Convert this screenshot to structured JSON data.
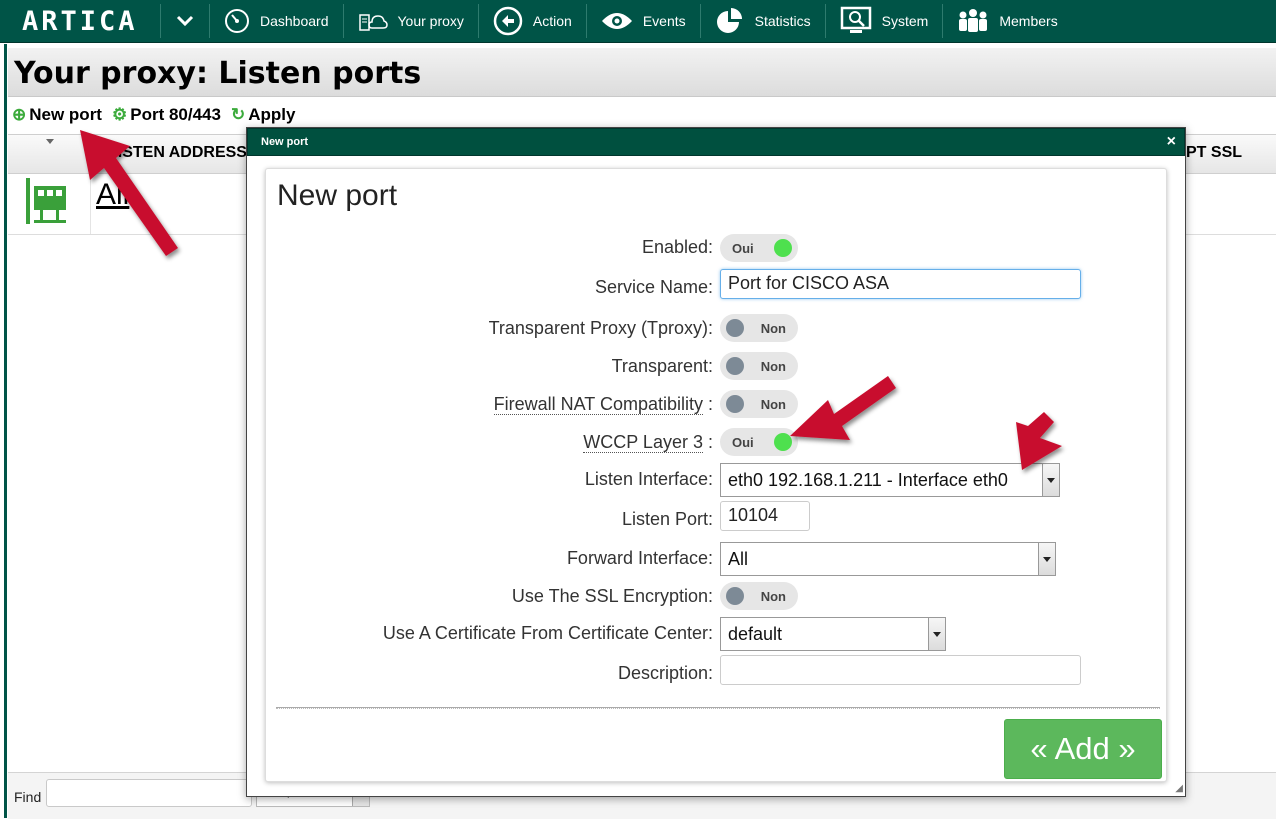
{
  "nav": {
    "logo": "ARTICA",
    "items": [
      {
        "label": "Dashboard",
        "icon": "dashboard-icon"
      },
      {
        "label": "Your proxy",
        "icon": "proxy-icon"
      },
      {
        "label": "Action",
        "icon": "action-icon"
      },
      {
        "label": "Events",
        "icon": "eye-icon"
      },
      {
        "label": "Statistics",
        "icon": "pie-chart-icon"
      },
      {
        "label": "System",
        "icon": "system-icon"
      },
      {
        "label": "Members",
        "icon": "members-icon"
      }
    ]
  },
  "page": {
    "title": "Your proxy: Listen ports",
    "toolbar": {
      "new_port": "New port",
      "port_80_443": "Port 80/443",
      "apply": "Apply"
    },
    "grid": {
      "columns": [
        "LISTEN ADDRESS",
        "PT SSL"
      ],
      "rows": [
        {
          "address": "All"
        }
      ]
    },
    "footer": {
      "find_label": "Find",
      "find_value": "",
      "search_field": "listen port"
    }
  },
  "modal": {
    "title": "New port",
    "close": "×",
    "panel_title": "New port",
    "fields": {
      "enabled": {
        "label": "Enabled:",
        "state": "Oui"
      },
      "service_name": {
        "label": "Service Name:",
        "value": "Port for CISCO ASA"
      },
      "tproxy": {
        "label": "Transparent Proxy (Tproxy):",
        "state": "Non"
      },
      "transparent": {
        "label": "Transparent:",
        "state": "Non"
      },
      "firewall_nat": {
        "label": "Firewall NAT Compatibility",
        "state": "Non"
      },
      "wccp": {
        "label": "WCCP Layer 3",
        "state": "Oui"
      },
      "listen_interface": {
        "label": "Listen Interface:",
        "value": "eth0 192.168.1.211 - Interface eth0"
      },
      "listen_port": {
        "label": "Listen Port:",
        "value": "10104"
      },
      "forward_interface": {
        "label": "Forward Interface:",
        "value": "All"
      },
      "ssl": {
        "label": "Use The SSL Encryption:",
        "state": "Non"
      },
      "certificate": {
        "label": "Use A Certificate From Certificate Center:",
        "value": "default"
      },
      "description": {
        "label": "Description:",
        "value": ""
      }
    },
    "add_button": "« Add »"
  },
  "colors": {
    "nav_bg": "#005447",
    "toggle_on": "#4ee04e",
    "toggle_off": "#7d8a96",
    "add_button": "#5cb85c",
    "annotation_arrow": "#c8102e"
  }
}
